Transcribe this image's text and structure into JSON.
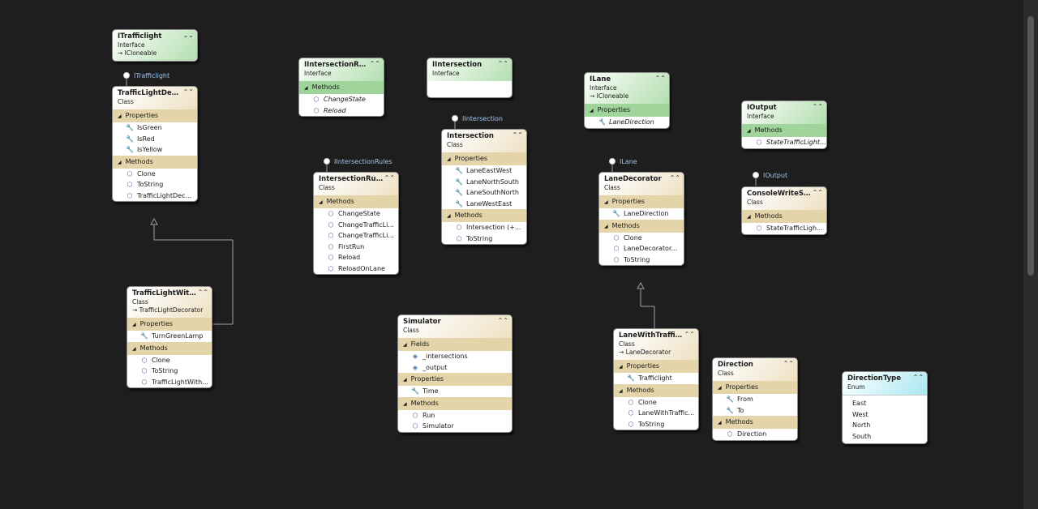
{
  "diagram": {
    "classes": [
      {
        "id": "ITrafficlight",
        "name": "ITrafficlight",
        "kind": "Interface",
        "variant": "iface",
        "collapse": "⌄⌄",
        "inherits": "ICloneable",
        "sections": []
      },
      {
        "id": "TrafficLightDecorator",
        "name": "TrafficLightDec...",
        "kind": "Class",
        "variant": "class",
        "collapse": "⌃⌃",
        "inherits": "",
        "sections": [
          {
            "title": "Properties",
            "members": [
              {
                "icon": "wrench",
                "name": "IsGreen"
              },
              {
                "icon": "wrench",
                "name": "IsRed"
              },
              {
                "icon": "wrench",
                "name": "IsYellow"
              }
            ]
          },
          {
            "title": "Methods",
            "members": [
              {
                "icon": "method",
                "name": "Clone"
              },
              {
                "icon": "method",
                "name": "ToString"
              },
              {
                "icon": "method",
                "name": "TrafficLightDec..."
              }
            ]
          }
        ]
      },
      {
        "id": "TrafficLightWith",
        "name": "TrafficLightWith...",
        "kind": "Class",
        "variant": "class",
        "collapse": "⌃⌃",
        "inherits": "TrafficLightDecorator",
        "sections": [
          {
            "title": "Properties",
            "members": [
              {
                "icon": "wrench",
                "name": "TurnGreenLamp"
              }
            ]
          },
          {
            "title": "Methods",
            "members": [
              {
                "icon": "method",
                "name": "Clone"
              },
              {
                "icon": "method",
                "name": "ToString"
              },
              {
                "icon": "method",
                "name": "TrafficLightWith..."
              }
            ]
          }
        ]
      },
      {
        "id": "IIntersectionRules",
        "name": "IIntersectionRules",
        "kind": "Interface",
        "variant": "iface",
        "collapse": "⌃⌃",
        "inherits": "",
        "sections": [
          {
            "title": "Methods",
            "members": [
              {
                "icon": "method",
                "name": "ChangeState",
                "italic": true
              },
              {
                "icon": "method",
                "name": "Reload",
                "italic": true
              }
            ]
          }
        ]
      },
      {
        "id": "IntersectionRules",
        "name": "IntersectionRules",
        "kind": "Class",
        "variant": "class",
        "collapse": "⌃⌃",
        "inherits": "",
        "sections": [
          {
            "title": "Methods",
            "members": [
              {
                "icon": "method",
                "name": "ChangeState"
              },
              {
                "icon": "method-private",
                "name": "ChangeTrafficLi..."
              },
              {
                "icon": "method-private",
                "name": "ChangeTrafficLi..."
              },
              {
                "icon": "method-private",
                "name": "FirstRun"
              },
              {
                "icon": "method",
                "name": "Reload"
              },
              {
                "icon": "method-private",
                "name": "ReloadOnLane"
              }
            ]
          }
        ]
      },
      {
        "id": "IIntersection",
        "name": "IIntersection",
        "kind": "Interface",
        "variant": "iface",
        "collapse": "⌃⌃",
        "inherits": "",
        "sections": []
      },
      {
        "id": "Intersection",
        "name": "Intersection",
        "kind": "Class",
        "variant": "class",
        "collapse": "⌃⌃",
        "inherits": "",
        "sections": [
          {
            "title": "Properties",
            "members": [
              {
                "icon": "wrench",
                "name": "LaneEastWest"
              },
              {
                "icon": "wrench",
                "name": "LaneNorthSouth"
              },
              {
                "icon": "wrench",
                "name": "LaneSouthNorth"
              },
              {
                "icon": "wrench",
                "name": "LaneWestEast"
              }
            ]
          },
          {
            "title": "Methods",
            "members": [
              {
                "icon": "method",
                "name": "Intersection (+..."
              },
              {
                "icon": "method",
                "name": "ToString"
              }
            ]
          }
        ]
      },
      {
        "id": "ILane",
        "name": "ILane",
        "kind": "Interface",
        "variant": "iface",
        "collapse": "⌃⌃",
        "inherits": "ICloneable",
        "sections": [
          {
            "title": "Properties",
            "members": [
              {
                "icon": "wrench",
                "name": "LaneDirection",
                "italic": true
              }
            ]
          }
        ]
      },
      {
        "id": "LaneDecorator",
        "name": "LaneDecorator",
        "kind": "Class",
        "variant": "class",
        "collapse": "⌃⌃",
        "inherits": "",
        "sections": [
          {
            "title": "Properties",
            "members": [
              {
                "icon": "wrench",
                "name": "LaneDirection"
              }
            ]
          },
          {
            "title": "Methods",
            "members": [
              {
                "icon": "method",
                "name": "Clone"
              },
              {
                "icon": "method",
                "name": "LaneDecorator..."
              },
              {
                "icon": "method",
                "name": "ToString"
              }
            ]
          }
        ]
      },
      {
        "id": "LaneWithTraffic",
        "name": "LaneWithTraffic...",
        "kind": "Class",
        "variant": "class",
        "collapse": "⌃⌃",
        "inherits": "LaneDecorator",
        "sections": [
          {
            "title": "Properties",
            "members": [
              {
                "icon": "wrench",
                "name": "Trafficlight"
              }
            ]
          },
          {
            "title": "Methods",
            "members": [
              {
                "icon": "method",
                "name": "Clone"
              },
              {
                "icon": "method",
                "name": "LaneWithTraffic..."
              },
              {
                "icon": "method",
                "name": "ToString"
              }
            ]
          }
        ]
      },
      {
        "id": "IOutput",
        "name": "IOutput",
        "kind": "Interface",
        "variant": "iface",
        "collapse": "⌃⌃",
        "inherits": "",
        "sections": [
          {
            "title": "Methods",
            "members": [
              {
                "icon": "method",
                "name": "StateTrafficLightO...",
                "italic": true
              }
            ]
          }
        ]
      },
      {
        "id": "ConsoleWriteSt",
        "name": "ConsoleWriteSt...",
        "kind": "Class",
        "variant": "class",
        "collapse": "⌃⌃",
        "inherits": "",
        "sections": [
          {
            "title": "Methods",
            "members": [
              {
                "icon": "method",
                "name": "StateTrafficLigh..."
              }
            ]
          }
        ]
      },
      {
        "id": "Simulator",
        "name": "Simulator",
        "kind": "Class",
        "variant": "class",
        "collapse": "⌃⌃",
        "inherits": "",
        "sections": [
          {
            "title": "Fields",
            "members": [
              {
                "icon": "field",
                "name": "_intersections"
              },
              {
                "icon": "field",
                "name": "_output"
              }
            ]
          },
          {
            "title": "Properties",
            "members": [
              {
                "icon": "wrench",
                "name": "Time"
              }
            ]
          },
          {
            "title": "Methods",
            "members": [
              {
                "icon": "method",
                "name": "Run"
              },
              {
                "icon": "method",
                "name": "Simulator"
              }
            ]
          }
        ]
      },
      {
        "id": "Direction",
        "name": "Direction",
        "kind": "Class",
        "variant": "class",
        "collapse": "⌃⌃",
        "inherits": "",
        "sections": [
          {
            "title": "Properties",
            "members": [
              {
                "icon": "wrench",
                "name": "From"
              },
              {
                "icon": "wrench",
                "name": "To"
              }
            ]
          },
          {
            "title": "Methods",
            "members": [
              {
                "icon": "method",
                "name": "Direction"
              }
            ]
          }
        ]
      },
      {
        "id": "DirectionType",
        "name": "DirectionType",
        "kind": "Enum",
        "variant": "enum",
        "collapse": "⌃⌃",
        "inherits": "",
        "sections": [],
        "values": [
          "East",
          "West",
          "North",
          "South"
        ]
      }
    ],
    "lollipops": [
      {
        "id": "lol-itrafficlight",
        "label": "ITrafficlight"
      },
      {
        "id": "lol-iintersectionrules",
        "label": "IIntersectionRules"
      },
      {
        "id": "lol-iintersection",
        "label": "IIntersection"
      },
      {
        "id": "lol-ilane",
        "label": "ILane"
      },
      {
        "id": "lol-ioutput",
        "label": "IOutput"
      }
    ],
    "colors": {
      "background": "#1e1e1e",
      "class_header": "#eee0c2",
      "class_section": "#e4d4a9",
      "interface_header": "#b3deb0",
      "interface_section": "#9fd49a",
      "enum_header": "#a9e6f0",
      "lollipop_label": "#9fc7ee"
    }
  }
}
